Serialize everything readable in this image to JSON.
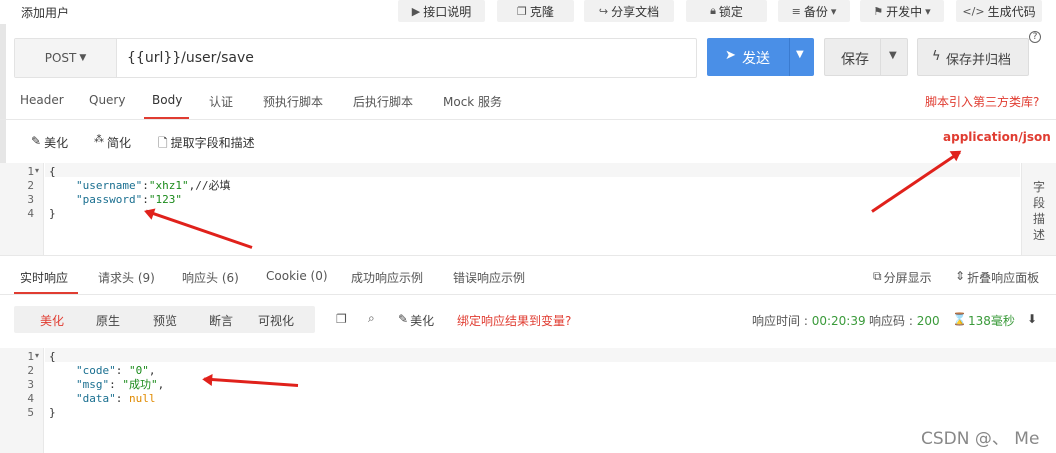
{
  "window_title": "添加用户",
  "toolbar": {
    "api_doc": "接口说明",
    "clone": "克隆",
    "share": "分享文档",
    "lock": "锁定",
    "backup": "备份",
    "dev_status": "开发中",
    "gen_code": "生成代码"
  },
  "request": {
    "method": "POST",
    "url": "{{url}}/user/save",
    "send": "发送",
    "save": "保存",
    "save_archive": "保存并归档",
    "help": "?"
  },
  "tabs": [
    "Header",
    "Query",
    "Body",
    "认证",
    "预执行脚本",
    "后执行脚本",
    "Mock 服务"
  ],
  "active_tab": "Body",
  "script_link": "脚本引入第三方类库?",
  "body_tools": {
    "beautify": "美化",
    "simplify": "简化",
    "extract": "提取字段和描述",
    "content_type": "application/json"
  },
  "body_editor": {
    "line_numbers": [
      "1",
      "2",
      "3",
      "4"
    ],
    "open_brace": "{",
    "l2_key": "\"username\"",
    "l2_colon": ":",
    "l2_val": "\"xhz1\"",
    "l2_comment": ",//必填",
    "l3_key": "\"password\"",
    "l3_colon": ":",
    "l3_val": "\"123\"",
    "close_brace": "}"
  },
  "field_desc_panel": "字段描述",
  "response_tabs": [
    "实时响应",
    "请求头 (9)",
    "响应头 (6)",
    "Cookie (0)",
    "成功响应示例",
    "错误响应示例"
  ],
  "response_right": {
    "split": "分屏显示",
    "collapse": "折叠响应面板"
  },
  "view_modes": [
    "美化",
    "原生",
    "预览",
    "断言",
    "可视化"
  ],
  "response_tools": {
    "beautify": "美化",
    "bind_var": "绑定响应结果到变量?"
  },
  "response_meta": {
    "time_label": "响应时间 : ",
    "time_value": "00:20:39",
    "code_label": "响应码 : ",
    "code_value": "200",
    "duration": "138毫秒"
  },
  "response_editor": {
    "line_numbers": [
      "1",
      "2",
      "3",
      "4",
      "5"
    ],
    "open_brace": "{",
    "l2_key": "\"code\"",
    "l2_val": "\"0\"",
    "l3_key": "\"msg\"",
    "l3_val": "\"成功\"",
    "l4_key": "\"data\"",
    "l4_val": "null",
    "close_brace": "}"
  },
  "watermark": "CSDN @、 Me",
  "colors": {
    "accent_blue": "#4a8fe7",
    "active_red": "#e03c31",
    "arrow_red": "#e0211b"
  }
}
